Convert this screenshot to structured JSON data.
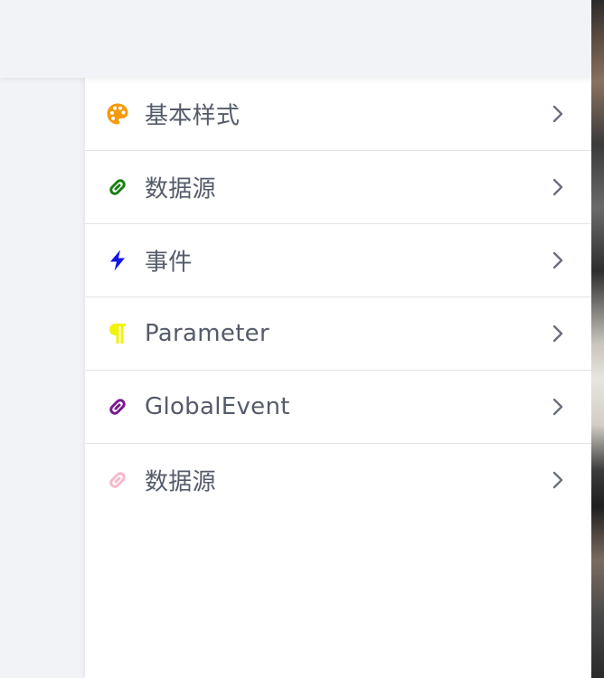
{
  "menu": {
    "items": [
      {
        "label": "基本样式",
        "icon": "palette-icon",
        "icon_color": "#f59a0c"
      },
      {
        "label": "数据源",
        "icon": "link-icon",
        "icon_color": "#1a7f12"
      },
      {
        "label": "事件",
        "icon": "lightning-bolt-icon",
        "icon_color": "#1414e6"
      },
      {
        "label": "Parameter",
        "icon": "paragraph-icon",
        "icon_color": "#f2f20a"
      },
      {
        "label": "GlobalEvent",
        "icon": "link-icon",
        "icon_color": "#7a1a8f"
      },
      {
        "label": "数据源",
        "icon": "link-icon",
        "icon_color": "#f7b8c8"
      }
    ],
    "chevron_color": "#6a6f7c",
    "label_color": "#555b6a"
  }
}
